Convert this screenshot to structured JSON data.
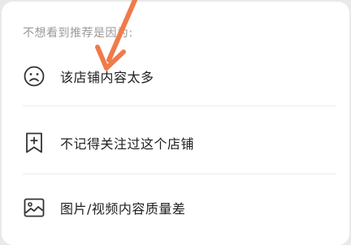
{
  "heading": "不想看到推荐是因为:",
  "options": [
    {
      "label": "该店铺内容太多",
      "icon": "sad-face-icon"
    },
    {
      "label": "不记得关注过这个店铺",
      "icon": "bookmark-add-icon"
    },
    {
      "label": "图片/视频内容质量差",
      "icon": "image-icon"
    }
  ],
  "colors": {
    "arrow": "#f07a4a",
    "text": "#1f1f1f",
    "heading": "#9a9a9a",
    "icon": "#333333"
  }
}
